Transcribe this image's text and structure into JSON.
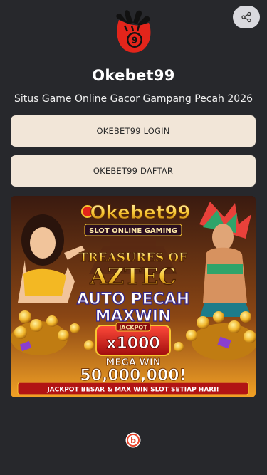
{
  "header": {
    "share_icon": "share-icon"
  },
  "profile": {
    "avatar_icon": "hand-coin-9-logo",
    "avatar_digit": "9",
    "name": "Okebet99",
    "description": "Situs Game Online Gacor Gampang Pecah 2026"
  },
  "links": [
    {
      "label": "OKEBET99 LOGIN"
    },
    {
      "label": "OKEBET99 DAFTAR"
    }
  ],
  "banner": {
    "brand": "Okebet99",
    "tagline": "SLOT ONLINE GAMING",
    "game_line1": "TREASURES OF",
    "game_line2": "AZTEC",
    "promo_line1": "AUTO PECAH",
    "promo_line2": "MAXWIN",
    "jackpot_label": "JACKPOT",
    "multiplier": "x1000",
    "mega_win": "MEGA WIN",
    "amount": "50,000,000!",
    "ribbon": "JACKPOT BESAR & MAX WIN SLOT SETIAP HARI!"
  },
  "footer": {
    "logo_icon": "bio-link-logo-icon",
    "logo_letter": "b"
  },
  "colors": {
    "background": "#27282c",
    "button_bg": "#f2e6d8",
    "button_text": "#2a2a2a",
    "accent_red": "#e3251b",
    "gold": "#f7c531"
  }
}
